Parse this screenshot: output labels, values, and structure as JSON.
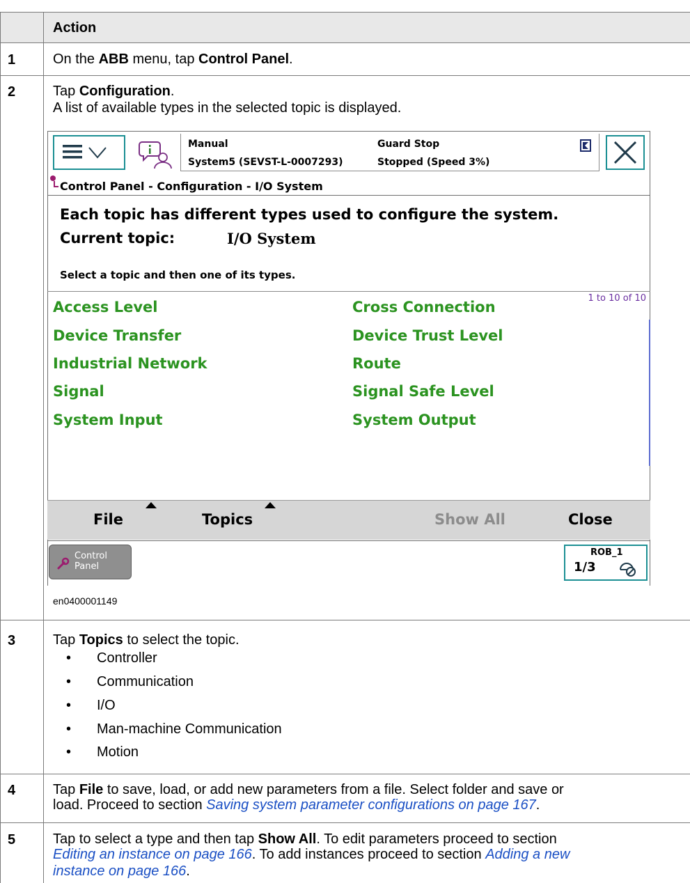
{
  "table": {
    "header": "Action",
    "steps": [
      {
        "num": "1",
        "parts": [
          "On the ",
          "ABB",
          " menu, tap ",
          "Control Panel",
          "."
        ]
      },
      {
        "num": "2",
        "line1": [
          "Tap ",
          "Configuration",
          "."
        ],
        "line2": "A list of available types in the selected topic is displayed."
      },
      {
        "num": "3",
        "parts": [
          "Tap ",
          "Topics",
          " to select the topic."
        ],
        "bullets": [
          "Controller",
          "Communication",
          "I/O",
          "Man-machine Communication",
          "Motion"
        ]
      },
      {
        "num": "4",
        "line1": [
          "Tap ",
          "File",
          " to save, load, or add new parameters from a file. Select folder and save or"
        ],
        "line2": [
          "load. Proceed to section ",
          "Saving system parameter configurations on page 167",
          "."
        ]
      },
      {
        "num": "5",
        "line1": [
          "Tap to select a type and then tap ",
          "Show All",
          ". To edit parameters proceed to section"
        ],
        "line2": [
          "Editing an instance on page 166",
          ". To add instances proceed to section ",
          "Adding a new"
        ],
        "line3": [
          "instance on page 166",
          "."
        ]
      }
    ],
    "figure_caption": "en0400001149"
  },
  "pendant": {
    "status": {
      "mode": "Manual",
      "system": "System5 (SEVST-L-0007293)",
      "state": "Guard Stop",
      "speed": "Stopped (Speed 3%)"
    },
    "breadcrumb": "Control Panel - Configuration - I/O System",
    "description": "Each topic has different types used to configure the system.",
    "current_topic_label": "Current topic:",
    "current_topic_value": "I/O System",
    "instruction": "Select a topic and then one of its types.",
    "count": "1 to 10 of 10",
    "types": [
      "Access Level",
      "Cross Connection",
      "Device Transfer",
      "Device Trust Level",
      "Industrial Network",
      "Route",
      "Signal",
      "Signal Safe Level",
      "System Input",
      "System Output"
    ],
    "commands": {
      "file": "File",
      "topics": "Topics",
      "show_all": "Show All",
      "close": "Close"
    },
    "taskbar": {
      "app_line1": "Control",
      "app_line2": "Panel",
      "rob": "ROB_1",
      "fraction": "1/3"
    },
    "colors": {
      "teal": "#1b8f93",
      "green": "#2b9320",
      "purple": "#6a2ea0",
      "link": "#1a4fc4"
    }
  }
}
